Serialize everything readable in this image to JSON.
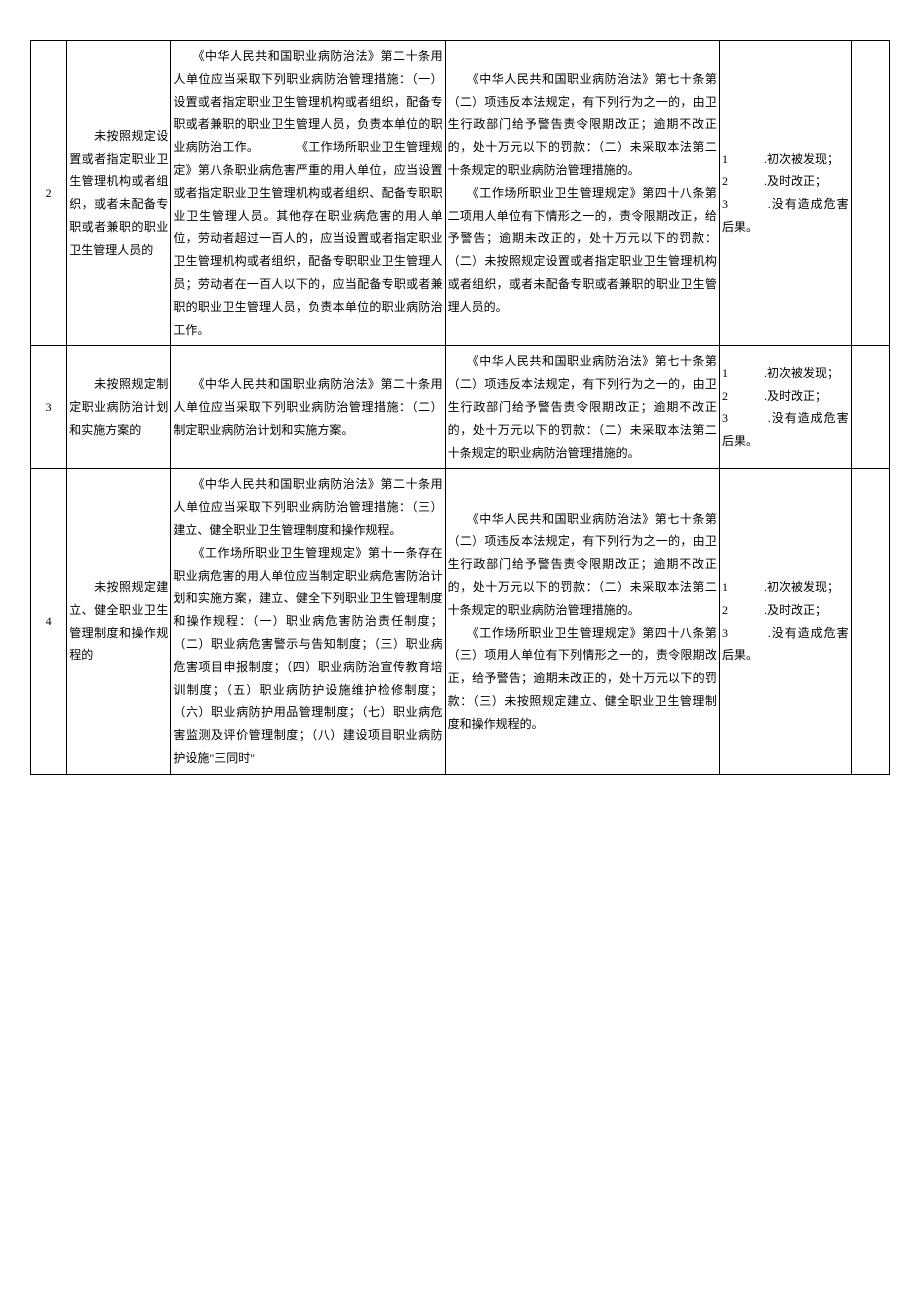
{
  "rows": [
    {
      "num": "2",
      "col2": "　　未按照规定设置或者指定职业卫生管理机构或者组织，或者未配备专职或者兼职的职业卫生管理人员的",
      "col3": "　　《中华人民共和国职业病防治法》第二十条用人单位应当采取下列职业病防治管理措施：（一）设置或者指定职业卫生管理机构或者组织，配备专职或者兼职的职业卫生管理人员，负责本单位的职业病防治工作。　　　　《工作场所职业卫生管理规定》第八条职业病危害严重的用人单位，应当设置或者指定职业卫生管理机构或者组织、配备专职职业卫生管理人员。其他存在职业病危害的用人单位，劳动者超过一百人的，应当设置或者指定职业卫生管理机构或者组织，配备专职职业卫生管理人员；劳动者在一百人以下的，应当配备专职或者兼职的职业卫生管理人员，负责本单位的职业病防治工作。",
      "col4": "　　《中华人民共和国职业病防治法》第七十条第（二）项违反本法规定，有下列行为之一的，由卫生行政部门给予警告责令限期改正；逾期不改正的，处十万元以下的罚款：（二）未采取本法第二十条规定的职业病防治管理措施的。\n　　《工作场所职业卫生管理规定》第四十八条第二项用人单位有下情形之一的，责令限期改正，给予警告；逾期未改正的，处十万元以下的罚款：（二）未按照规定设置或者指定职业卫生管理机构或者组织，或者未配备专职或者兼职的职业卫生管理人员的。",
      "col5": "1　　　.初次被发现；\n2　　　.及时改正；\n3　　　.没有造成危害后果。",
      "col6": ""
    },
    {
      "num": "3",
      "col2": "　　未按照规定制定职业病防治计划和实施方案的",
      "col3": "　　《中华人民共和国职业病防治法》第二十条用人单位应当采取下列职业病防治管理措施：（二）制定职业病防治计划和实施方案。",
      "col4": "　　《中华人民共和国职业病防治法》第七十条第（二）项违反本法规定，有下列行为之一的，由卫生行政部门给予警告责令限期改正；逾期不改正的，处十万元以下的罚款：（二）未采取本法第二十条规定的职业病防治管理措施的。",
      "col5": "1　　　.初次被发现；\n2　　　.及时改正；\n3　　　.没有造成危害后果。",
      "col6": ""
    },
    {
      "num": "4",
      "col2": "　　未按照规定建立、健全职业卫生管理制度和操作规程的",
      "col3": "　　《中华人民共和国职业病防治法》第二十条用人单位应当采取下列职业病防治管理措施：（三）建立、健全职业卫生管理制度和操作规程。\n　　《工作场所职业卫生管理规定》第十一条存在职业病危害的用人单位应当制定职业病危害防治计划和实施方案，建立、健全下列职业卫生管理制度和操作规程：（一）职业病危害防治责任制度；（二）职业病危害警示与告知制度；（三）职业病危害项目申报制度；（四）职业病防治宣传教育培训制度；（五）职业病防护设施维护检修制度；（六）职业病防护用品管理制度；（七）职业病危害监测及评价管理制度；（八）建设项目职业病防护设施\"三同时\"",
      "col4": "　　《中华人民共和国职业病防治法》第七十条第（二）项违反本法规定，有下列行为之一的，由卫生行政部门给予警告责令限期改正；逾期不改正的，处十万元以下的罚款：（二）未采取本法第二十条规定的职业病防治管理措施的。\n　　《工作场所职业卫生管理规定》第四十八条第（三）项用人单位有下列情形之一的，责令限期改正，给予警告；逾期未改正的，处十万元以下的罚款：（三）未按照规定建立、健全职业卫生管理制度和操作规程的。",
      "col5": "1　　　.初次被发现；\n2　　　.及时改正；\n3　　　.没有造成危害后果。",
      "col6": ""
    }
  ]
}
